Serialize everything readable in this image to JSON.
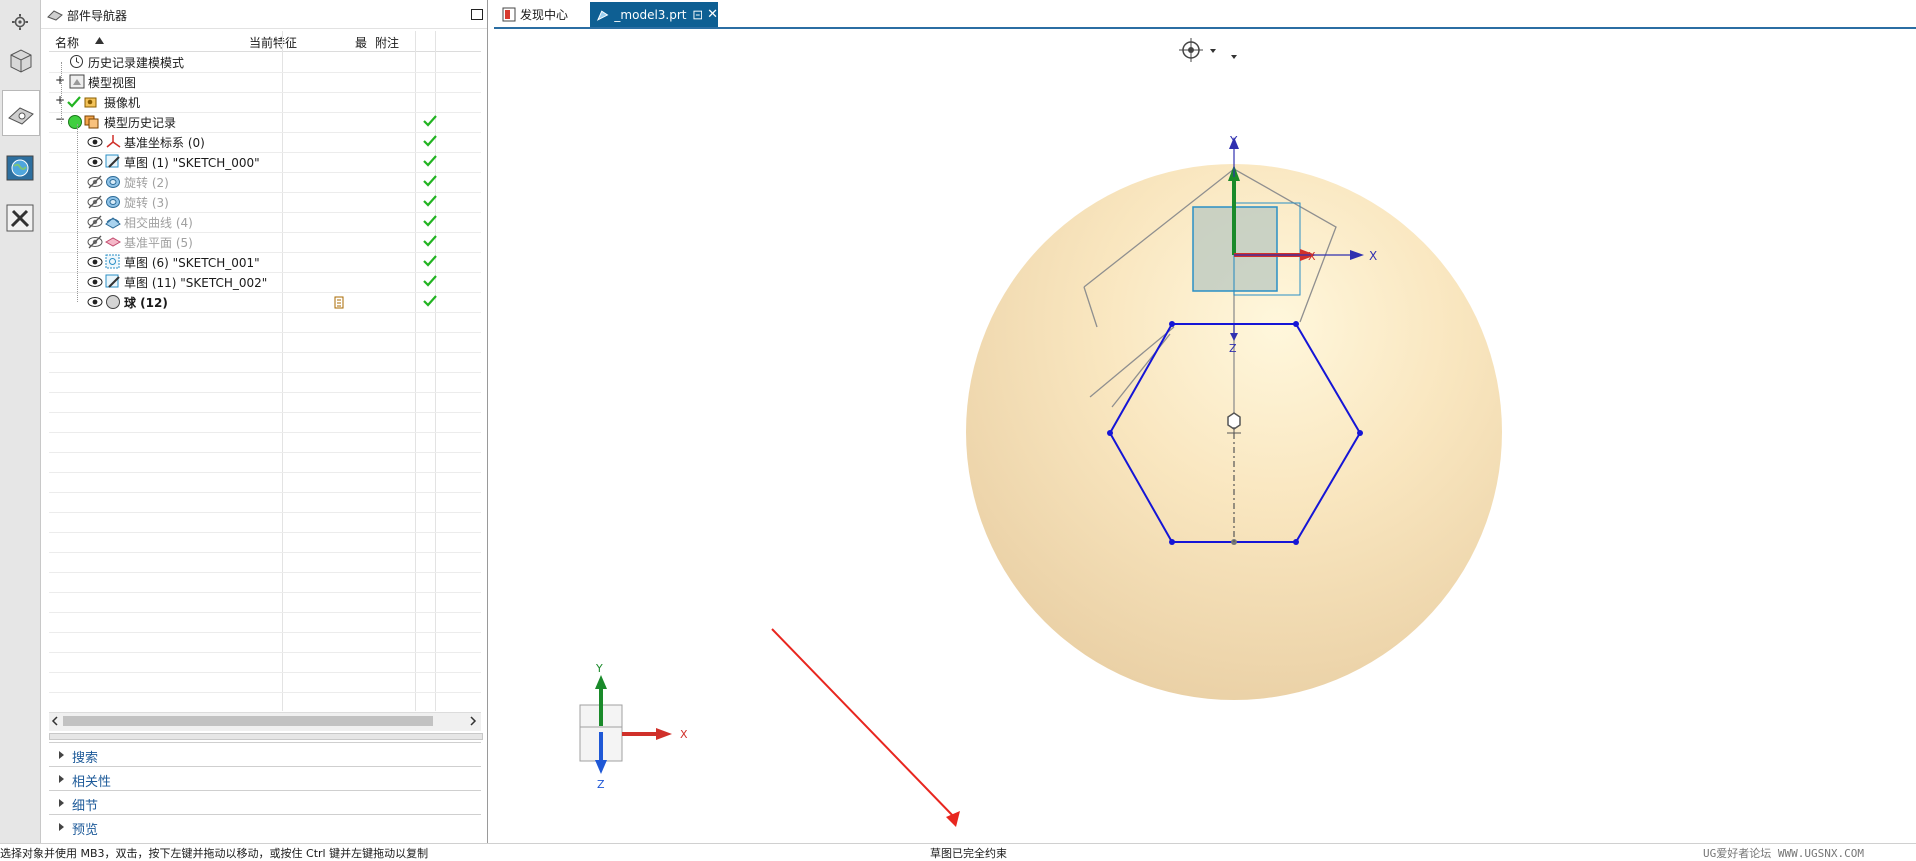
{
  "navigator": {
    "title": "部件导航器",
    "columns": {
      "name": "名称",
      "current": "当前特征",
      "latest": "最",
      "notes": "附注"
    },
    "rows": [
      {
        "label": "历史记录建模模式",
        "style": "normal"
      },
      {
        "label": "模型视图",
        "style": "normal"
      },
      {
        "label": "摄像机",
        "style": "normal"
      },
      {
        "label": "模型历史记录",
        "style": "normal"
      },
      {
        "label": "基准坐标系 (0)",
        "style": "normal"
      },
      {
        "label": "草图 (1) \"SKETCH_000\"",
        "style": "normal"
      },
      {
        "label": "旋转 (2)",
        "style": "gray"
      },
      {
        "label": "旋转 (3)",
        "style": "gray"
      },
      {
        "label": "相交曲线 (4)",
        "style": "gray"
      },
      {
        "label": "基准平面 (5)",
        "style": "gray"
      },
      {
        "label": "草图 (6) \"SKETCH_001\"",
        "style": "normal"
      },
      {
        "label": "草图 (11) \"SKETCH_002\"",
        "style": "normal"
      },
      {
        "label": "球 (12)",
        "style": "bold"
      }
    ],
    "panels": [
      "搜索",
      "相关性",
      "细节",
      "预览"
    ]
  },
  "tabs": [
    {
      "label": "发现中心"
    },
    {
      "label": "_model3.prt"
    }
  ],
  "viewport": {
    "axis_labels": {
      "x": "X",
      "y": "Y",
      "z": "Z"
    },
    "triad_labels": {
      "x": "X",
      "y": "Y",
      "z": "Z"
    }
  },
  "status": {
    "left": "选择对象并使用 MB3，双击，按下左键并拖动以移动，或按住 Ctrl 键并左键拖动以复制",
    "center": "草图已完全约束",
    "watermark": "UG爱好者论坛 WWW.UGSNX.COM"
  },
  "colors": {
    "accent": "#0e5f93",
    "check": "#22b422",
    "sketch": "#1515d6",
    "sphere": "#f5d9a8",
    "annotation": "#e8261f"
  },
  "icons": {
    "settings": "gear-icon",
    "part": "cube-icon",
    "navigator": "part-navigator-icon",
    "web": "globe-icon",
    "tools": "tools-icon",
    "eye": "eye-icon",
    "check": "check-icon"
  }
}
